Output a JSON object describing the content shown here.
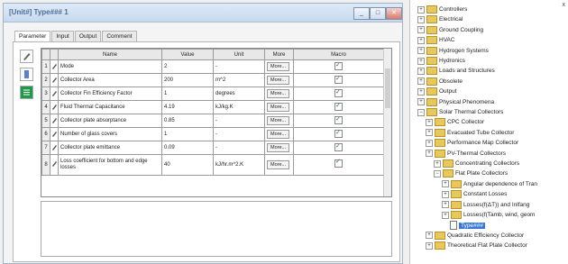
{
  "window": {
    "title": "[Unit#] Type### 1",
    "btn_min": "_",
    "btn_max": "□",
    "btn_close": "✕"
  },
  "tabs": [
    "Parameter",
    "Input",
    "Output",
    "Comment"
  ],
  "grid": {
    "headers": [
      "",
      "",
      "Name",
      "Value",
      "Unit",
      "More",
      "Macro"
    ],
    "rows": [
      {
        "num": "1",
        "name": "Mode",
        "value": "2",
        "unit": "-",
        "more": "More...",
        "macro": true
      },
      {
        "num": "2",
        "name": "Collector Area",
        "value": "200",
        "unit": "m^2",
        "more": "More...",
        "macro": true
      },
      {
        "num": "3",
        "name": "Collector Fin Efficiency Factor",
        "value": "1",
        "unit": "degrees",
        "more": "More...",
        "macro": true
      },
      {
        "num": "4",
        "name": "Fluid Thermal Capacitance",
        "value": "4.19",
        "unit": "kJ/kg.K",
        "more": "More...",
        "macro": true
      },
      {
        "num": "5",
        "name": "Collector plate absorptance",
        "value": "0.85",
        "unit": "-",
        "more": "More...",
        "macro": true
      },
      {
        "num": "6",
        "name": "Number of glass covers",
        "value": "1",
        "unit": "-",
        "more": "More...",
        "macro": true
      },
      {
        "num": "7",
        "name": "Collector plate emittance",
        "value": "0.09",
        "unit": "-",
        "more": "More...",
        "macro": true
      },
      {
        "num": "8",
        "name": "Loss coefficient for bottom and edge losses",
        "value": "40",
        "unit": "kJ/hr.m^2.K",
        "more": "More...",
        "macro": true
      }
    ]
  },
  "tree": {
    "close": "x",
    "items": [
      {
        "label": "Controllers",
        "exp": "+"
      },
      {
        "label": "Electrical",
        "exp": "+"
      },
      {
        "label": "Ground Coupling",
        "exp": "+"
      },
      {
        "label": "HVAC",
        "exp": "+"
      },
      {
        "label": "Hydrogen Systems",
        "exp": "+"
      },
      {
        "label": "Hydronics",
        "exp": "+"
      },
      {
        "label": "Loads and Structures",
        "exp": "+"
      },
      {
        "label": "Obsolete",
        "exp": "+"
      },
      {
        "label": "Output",
        "exp": "+"
      },
      {
        "label": "Physical Phenomena",
        "exp": "+"
      },
      {
        "label": "Solar Thermal Collectors",
        "exp": "−"
      },
      {
        "label": "CPC Collector",
        "exp": "+"
      },
      {
        "label": "Evacuated Tube Collector",
        "exp": "+"
      },
      {
        "label": "Performance Map Collector",
        "exp": "+"
      },
      {
        "label": "PV-Thermal Collectors",
        "exp": "+"
      },
      {
        "label": "Concentrating Collectors",
        "exp": "+"
      },
      {
        "label": "Flat Plate Collectors",
        "exp": "−"
      },
      {
        "label": "Angular dependence of Tran",
        "exp": "+"
      },
      {
        "label": "Constant Losses",
        "exp": "+"
      },
      {
        "label": "Losses(f(ΔT)) and Inlfang",
        "exp": "+"
      },
      {
        "label": "Losses(f(Tamb, wind, geom",
        "exp": "+"
      },
      {
        "label": "Type###",
        "exp": ""
      },
      {
        "label": "Quadratic Efficiency Collector",
        "exp": "+"
      },
      {
        "label": "Theoretical Flat Plate Collector",
        "exp": "+"
      }
    ]
  },
  "colors": {
    "selection": "#3a78d6",
    "folder": "#e8c75b"
  }
}
